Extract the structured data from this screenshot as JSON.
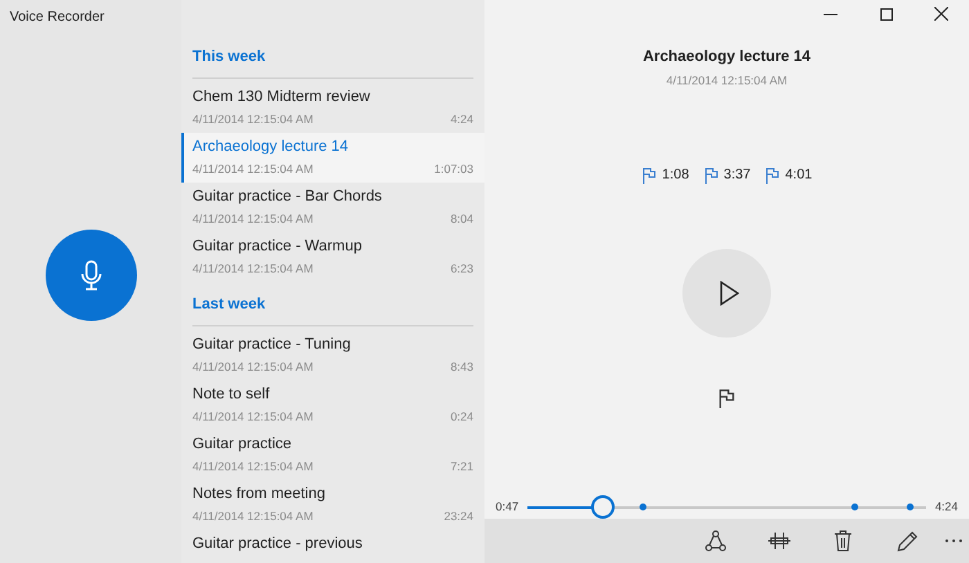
{
  "window": {
    "title": "Voice Recorder"
  },
  "groups": [
    {
      "heading": "This week",
      "items": [
        {
          "title": "Chem 130 Midterm review",
          "date": "4/11/2014 12:15:04 AM",
          "duration": "4:24",
          "selected": false
        },
        {
          "title": "Archaeology lecture 14",
          "date": "4/11/2014 12:15:04 AM",
          "duration": "1:07:03",
          "selected": true
        },
        {
          "title": "Guitar practice - Bar Chords",
          "date": "4/11/2014 12:15:04 AM",
          "duration": "8:04",
          "selected": false
        },
        {
          "title": "Guitar practice - Warmup",
          "date": "4/11/2014 12:15:04 AM",
          "duration": "6:23",
          "selected": false
        }
      ]
    },
    {
      "heading": "Last week",
      "items": [
        {
          "title": "Guitar practice - Tuning",
          "date": "4/11/2014 12:15:04 AM",
          "duration": "8:43",
          "selected": false
        },
        {
          "title": "Note to self",
          "date": "4/11/2014 12:15:04 AM",
          "duration": "0:24",
          "selected": false
        },
        {
          "title": "Guitar practice",
          "date": "4/11/2014 12:15:04 AM",
          "duration": "7:21",
          "selected": false
        },
        {
          "title": "Notes from meeting",
          "date": "4/11/2014 12:15:04 AM",
          "duration": "23:24",
          "selected": false
        },
        {
          "title": "Guitar practice - previous",
          "selected": false
        }
      ]
    }
  ],
  "detail": {
    "title": "Archaeology lecture 14",
    "date": "4/11/2014 12:15:04 AM",
    "flags": [
      "1:08",
      "3:37",
      "4:01"
    ],
    "slider": {
      "elapsed": "0:47",
      "total": "4:24",
      "level": 0.19,
      "markers": [
        {
          "level": 0.29
        },
        {
          "level": 0.82
        },
        {
          "level": 0.96
        }
      ]
    }
  }
}
